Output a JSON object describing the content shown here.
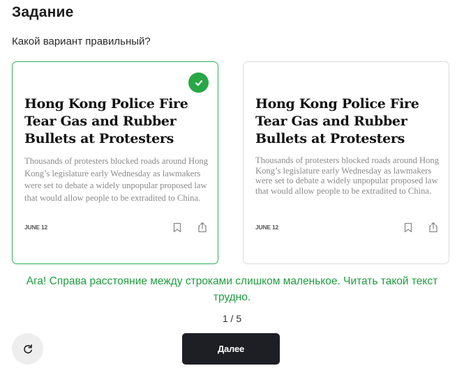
{
  "header": {
    "title": "Задание",
    "question": "Какой вариант правильный?"
  },
  "options": [
    {
      "selected": true,
      "headline": "Hong Kong Police Fire Tear Gas and Rubber Bullets at Protesters",
      "body": "Thousands of protesters blocked roads around Hong Kong’s legislature early Wednesday as lawmakers were set to debate a widely unpopular proposed law that would allow people to be extradited to China.",
      "date": "JUNE 12",
      "icons": [
        "bookmark-icon",
        "share-icon"
      ]
    },
    {
      "selected": false,
      "headline": "Hong Kong Police Fire Tear Gas and Rubber Bullets at Protesters",
      "body": "Thousands of protesters blocked roads around Hong Kong’s legislature early Wednesday as lawmakers were set to debate a widely unpopular proposed law that would allow people to be extradited to China.",
      "date": "JUNE 12",
      "icons": [
        "bookmark-icon",
        "share-icon"
      ]
    }
  ],
  "feedback": {
    "text": "Ага! Справа расстояние между строками слишком маленькое. Читать такой текст трудно."
  },
  "progress": {
    "current": 1,
    "total": 5,
    "label": "1 / 5"
  },
  "controls": {
    "next_label": "Далее",
    "restart_icon": "refresh-icon"
  },
  "colors": {
    "accent_green": "#28a745",
    "feedback_green": "#1f9d3f",
    "button_dark": "#1d1f24"
  }
}
